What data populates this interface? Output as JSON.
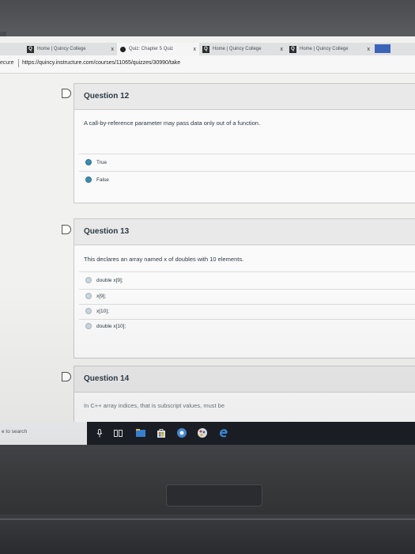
{
  "browser": {
    "tabs": [
      {
        "label": "Home | Quincy College",
        "active": false
      },
      {
        "label": "Quiz: Chapter 5 Quiz",
        "active": true
      },
      {
        "label": "Home | Quincy College",
        "active": false
      },
      {
        "label": "Home | Quincy College",
        "active": false
      }
    ],
    "tab_close": "x",
    "tab_fav_letter": "Q",
    "address": {
      "secure_label": "ecure",
      "url": "https://quincy.instructure.com/courses/11065/quizzes/30990/take"
    }
  },
  "quiz": {
    "questions": [
      {
        "title": "Question 12",
        "text": "A call-by-reference parameter may pass data only out of a function.",
        "answers": [
          "True",
          "False"
        ]
      },
      {
        "title": "Question 13",
        "text": "This declares an array named x of doubles with 10 elements.",
        "answers": [
          "double x[9];",
          "x[9];",
          "x[10];",
          "double x[10];"
        ]
      },
      {
        "title": "Question 14",
        "text": "In C++ array indices, that is subscript values, must be"
      }
    ]
  },
  "taskbar": {
    "search_placeholder": "e to search"
  },
  "colors": {
    "radio": "#3d8bb0",
    "taskbar": "#1b1f26",
    "tab_scroll": "#3b64b8"
  }
}
